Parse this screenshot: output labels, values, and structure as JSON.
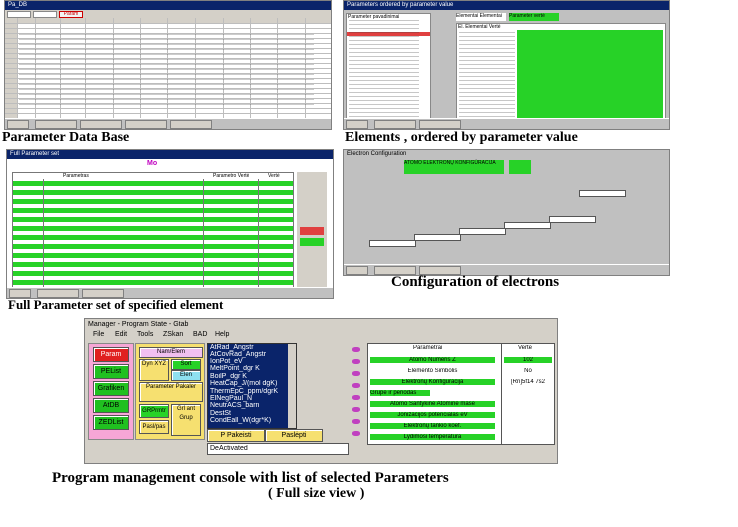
{
  "captions": {
    "parameter_db": "Parameter Data Base",
    "elements_ordered": "Elements , ordered by parameter value",
    "full_parameter": "Full Parameter set of specified element",
    "config_electrons": "Configuration of electrons",
    "console_line1": "Program management console with list of selected Parameters",
    "console_line2": "( Full size view )"
  },
  "console": {
    "title": "Manager - Program State - Gtab",
    "menu": [
      "File",
      "Edit",
      "Tools",
      "ZSkan",
      "BAD",
      "Help"
    ],
    "left_buttons": [
      "Param",
      "PEList",
      "Grafiken",
      "AtDB",
      "ZEDList"
    ],
    "mid_buttons": [
      "Nam/Elem",
      "Dyn XYZ",
      "Sort",
      "Elen",
      "Parameter Pakaler"
    ],
    "mid_buttons2": [
      "GRPrmtr",
      "Grl ant Grup",
      "Pasl/pas"
    ],
    "param_list": [
      "AtRad_Angstr",
      "AtCovRad_Angstr",
      "IonPot_eV",
      "MeltPoint_dgr K",
      "BoilP_dgr K",
      "HeatCap_J/(mol dgK)",
      "ThermEpC_ppm/dgrK",
      "ElNegPaul_N",
      "NeutrACS_barn",
      "DestSt",
      "CondEall_W(dgr*K)"
    ],
    "bottom_left_btn": "P Pakeisti",
    "bottom_right_btn": "Paslėpti",
    "status_value": "DeActivated",
    "table_header_param": "Parametrai",
    "table_header_value": "Vertė",
    "table_rows": [
      {
        "param": "Atomo Numeris Z",
        "value": "102"
      },
      {
        "param": "Elemento Simbolis",
        "value": "No"
      },
      {
        "param": "Elektronų Konfigūracija",
        "value": "[Rn]5f14 7s2"
      },
      {
        "param": "Grupė ir periodas",
        "value": ""
      },
      {
        "param": "Atomo Santykinė Atominė masė",
        "value": ""
      },
      {
        "param": "Jonizacijos potencialas eV",
        "value": ""
      },
      {
        "param": "Elektronų tankio koef.",
        "value": ""
      },
      {
        "param": "Lydimosi temperatūra",
        "value": ""
      }
    ]
  },
  "thumb_tl": {
    "title": "Pa_DB",
    "tab_label": "Param"
  },
  "thumb_tr": {
    "title": "Parameters ordered by parameter value",
    "h1": "Parameter pavadinimai",
    "h2": "Elementai Elementai",
    "h3": "Parameter vertė",
    "h4": "El. Elementai Vertė"
  },
  "thumb_ml": {
    "title": "Full Parameter set",
    "field": "Mo",
    "header1": "Parametras",
    "header2": "Parametro Vertė",
    "header3": "Vertė"
  },
  "thumb_mr": {
    "title": "Electron Configuration",
    "header": "ATOMO ELEKTRONŲ KONFIGŪRACIJA"
  }
}
